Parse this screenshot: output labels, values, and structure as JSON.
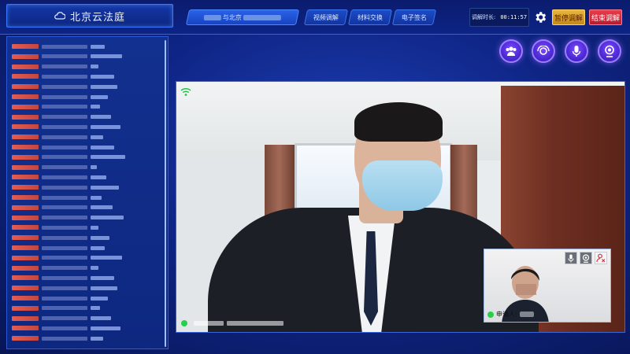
{
  "header": {
    "app_title": "北京云法庭",
    "case_tab": {
      "prefix_text": "与北京"
    },
    "nav_tabs": [
      "视频调解",
      "材料交换",
      "电子签名"
    ],
    "timer": {
      "label": "调解时长:",
      "value": "00:11:57"
    },
    "pause_label": "暂停调解",
    "end_label": "结束调解"
  },
  "participants": {
    "row_count": 30
  },
  "controls": {
    "icons": [
      "participants-icon",
      "camera-switch-icon",
      "microphone-icon",
      "camera-icon"
    ]
  },
  "main_video": {
    "caption_text": ""
  },
  "pip_video": {
    "caption_label": "申请人:",
    "icons": [
      "mic-icon",
      "camera-icon",
      "user-remove-icon"
    ]
  },
  "colors": {
    "pause_button": "#e8b63a",
    "end_button": "#ea3c4a",
    "accent_purple": "#6a3cf0",
    "status_green": "#25d04b"
  }
}
